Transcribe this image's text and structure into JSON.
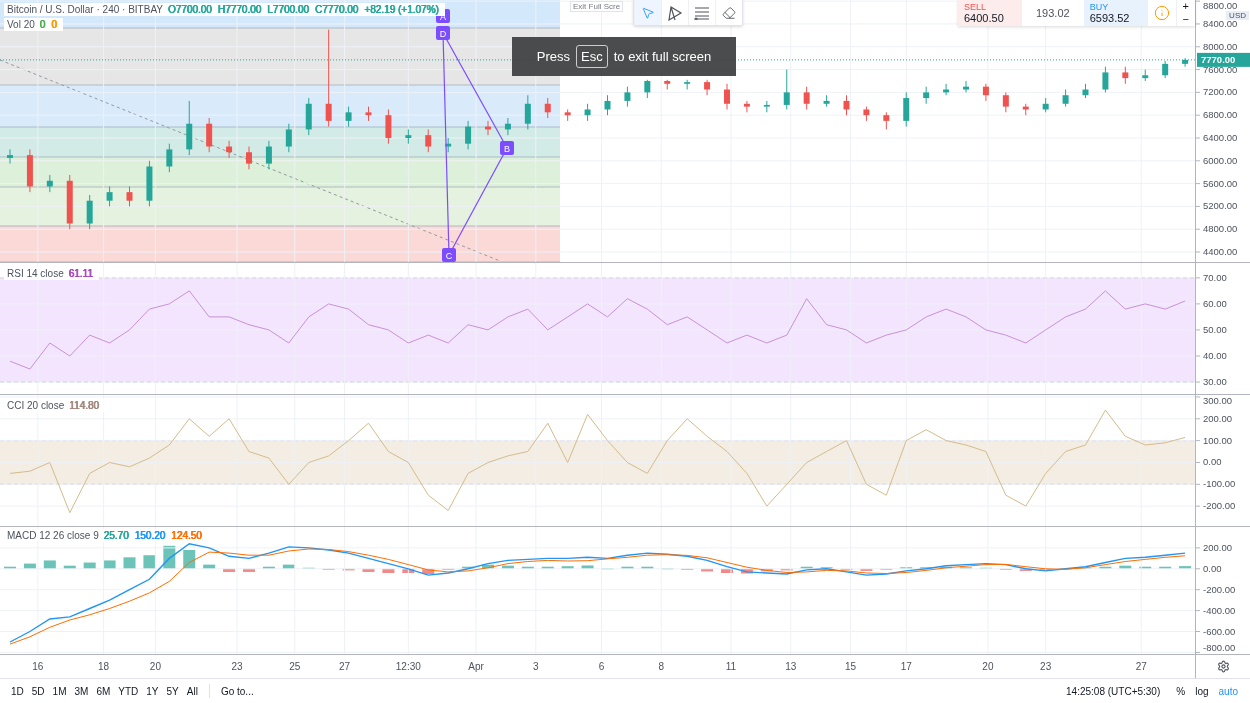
{
  "tooltip": {
    "text": "Exit Full Scre"
  },
  "drawing_toolbar": {
    "tools": [
      {
        "kind": "cursor",
        "selected": true
      },
      {
        "kind": "pattern",
        "selected": false
      },
      {
        "kind": "lines",
        "selected": false
      },
      {
        "kind": "eraser",
        "selected": false
      }
    ]
  },
  "trade_panel": {
    "sell": {
      "label": "SELL",
      "price": "6400.50"
    },
    "spread": "193.02",
    "buy": {
      "label": "BUY",
      "price": "6593.52"
    },
    "zoom_in": "+",
    "zoom_out": "−"
  },
  "toast": {
    "before": "Press",
    "key": "Esc",
    "after": "to exit full screen"
  },
  "price_pane": {
    "legend": {
      "title": "Bitcoin / U.S. Dollar · 240 · BITBAY",
      "values": [
        {
          "text": "O7700.00",
          "color": "#26a69a"
        },
        {
          "text": "H7770.00",
          "color": "#26a69a"
        },
        {
          "text": "L7700.00",
          "color": "#26a69a"
        },
        {
          "text": "C7770.00",
          "color": "#26a69a"
        },
        {
          "text": "+82.19 (+1.07%)",
          "color": "#26a69a"
        }
      ]
    },
    "volume_legend": {
      "title": "Vol 20",
      "values": [
        {
          "text": "0",
          "color": "#4caf50"
        },
        {
          "text": "0",
          "color": "#ff9800"
        }
      ]
    },
    "currency": "USD",
    "last_price": "7770.00",
    "pattern": {
      "points": [
        {
          "label": "A"
        },
        {
          "label": "D"
        },
        {
          "label": "B"
        },
        {
          "label": "C"
        }
      ]
    },
    "chart_data": {
      "type": "candlestick",
      "grid": true,
      "ylim": [
        4225,
        8820
      ],
      "yticks": [
        {
          "value": 8800,
          "label": "8800.00"
        },
        {
          "value": 8400,
          "label": "8400.00"
        },
        {
          "value": 8000,
          "label": "8000.00"
        },
        {
          "value": 7600,
          "label": "7600.00"
        },
        {
          "value": 7200,
          "label": "7200.00"
        },
        {
          "value": 6800,
          "label": "6800.00"
        },
        {
          "value": 6400,
          "label": "6400.00"
        },
        {
          "value": 6000,
          "label": "6000.00"
        },
        {
          "value": 5600,
          "label": "5600.00"
        },
        {
          "value": 5200,
          "label": "5200.00"
        },
        {
          "value": 4800,
          "label": "4800.00"
        },
        {
          "value": 4400,
          "label": "4400.00"
        }
      ],
      "ohlc": [
        [
          6050,
          6200,
          5950,
          6100
        ],
        [
          6100,
          6200,
          5450,
          5550
        ],
        [
          5550,
          5750,
          5450,
          5650
        ],
        [
          5650,
          5750,
          4800,
          4900
        ],
        [
          4900,
          5400,
          4800,
          5300
        ],
        [
          5300,
          5550,
          5200,
          5450
        ],
        [
          5450,
          5550,
          5200,
          5300
        ],
        [
          5300,
          6000,
          5200,
          5900
        ],
        [
          5900,
          6300,
          5800,
          6200
        ],
        [
          6200,
          7050,
          6100,
          6650
        ],
        [
          6650,
          6750,
          6150,
          6250
        ],
        [
          6250,
          6350,
          6050,
          6150
        ],
        [
          6150,
          6250,
          5850,
          5950
        ],
        [
          5950,
          6350,
          5850,
          6250
        ],
        [
          6250,
          6650,
          6150,
          6550
        ],
        [
          6550,
          7100,
          6450,
          7000
        ],
        [
          7000,
          8300,
          6600,
          6700
        ],
        [
          6700,
          6950,
          6600,
          6850
        ],
        [
          6850,
          6950,
          6700,
          6800
        ],
        [
          6800,
          6900,
          6300,
          6400
        ],
        [
          6400,
          6550,
          6300,
          6450
        ],
        [
          6450,
          6550,
          6150,
          6250
        ],
        [
          6250,
          6400,
          6150,
          6300
        ],
        [
          6300,
          6700,
          6200,
          6600
        ],
        [
          6600,
          6700,
          6450,
          6550
        ],
        [
          6550,
          6750,
          6450,
          6650
        ],
        [
          6650,
          7150,
          6550,
          7000
        ],
        [
          7000,
          7100,
          6750,
          6850
        ],
        [
          6850,
          6900,
          6700,
          6800
        ],
        [
          6800,
          7000,
          6700,
          6900
        ],
        [
          6900,
          7150,
          6800,
          7050
        ],
        [
          7050,
          7300,
          6950,
          7200
        ],
        [
          7200,
          7420,
          7100,
          7400
        ],
        [
          7400,
          7420,
          7250,
          7350
        ],
        [
          7350,
          7420,
          7250,
          7380
        ],
        [
          7380,
          7420,
          7150,
          7250
        ],
        [
          7250,
          7350,
          6900,
          7000
        ],
        [
          7000,
          7050,
          6850,
          6950
        ],
        [
          6950,
          7050,
          6850,
          6980
        ],
        [
          6980,
          7600,
          6900,
          7200
        ],
        [
          7200,
          7300,
          6900,
          7000
        ],
        [
          7000,
          7150,
          6950,
          7050
        ],
        [
          7050,
          7150,
          6800,
          6900
        ],
        [
          6900,
          6950,
          6700,
          6800
        ],
        [
          6800,
          6850,
          6550,
          6700
        ],
        [
          6700,
          7200,
          6600,
          7100
        ],
        [
          7100,
          7300,
          7000,
          7200
        ],
        [
          7200,
          7350,
          7150,
          7250
        ],
        [
          7250,
          7400,
          7200,
          7300
        ],
        [
          7300,
          7350,
          7050,
          7150
        ],
        [
          7150,
          7200,
          6850,
          6950
        ],
        [
          6950,
          7000,
          6800,
          6900
        ],
        [
          6900,
          7100,
          6850,
          7000
        ],
        [
          7000,
          7250,
          6950,
          7150
        ],
        [
          7150,
          7350,
          7100,
          7250
        ],
        [
          7250,
          7650,
          7200,
          7550
        ],
        [
          7550,
          7650,
          7350,
          7450
        ],
        [
          7450,
          7600,
          7400,
          7500
        ],
        [
          7500,
          7750,
          7450,
          7700
        ],
        [
          7700,
          7800,
          7650,
          7770
        ]
      ]
    }
  },
  "rsi_pane": {
    "legend": {
      "title": "RSI 14 close",
      "values": [
        {
          "text": "61.11",
          "color": "#ab47bc"
        }
      ]
    },
    "chart_data": {
      "type": "line",
      "grid": true,
      "ylim": [
        25.4,
        75.7
      ],
      "yticks": [
        {
          "value": 70,
          "label": "70.00"
        },
        {
          "value": 60,
          "label": "60.00"
        },
        {
          "value": 50,
          "label": "50.00"
        },
        {
          "value": 40,
          "label": "40.00"
        },
        {
          "value": 30,
          "label": "30.00"
        }
      ],
      "series": [
        {
          "color": "#c792d8",
          "values": [
            38,
            35,
            45,
            40,
            48,
            45,
            50,
            58,
            60,
            65,
            55,
            55,
            52,
            50,
            45,
            55,
            60,
            58,
            52,
            50,
            45,
            48,
            45,
            52,
            50,
            55,
            58,
            50,
            55,
            60,
            55,
            62,
            58,
            52,
            55,
            50,
            45,
            48,
            45,
            48,
            62,
            52,
            50,
            45,
            48,
            50,
            55,
            58,
            55,
            50,
            48,
            45,
            50,
            55,
            58,
            65,
            58,
            60,
            58,
            61.11
          ]
        }
      ]
    }
  },
  "cci_pane": {
    "legend": {
      "title": "CCI 20 close",
      "values": [
        {
          "text": "114.80",
          "color": "#a1887f"
        }
      ]
    },
    "chart_data": {
      "type": "line",
      "grid": true,
      "ylim": [
        -291,
        309
      ],
      "yticks": [
        {
          "value": 300,
          "label": "300.00"
        },
        {
          "value": 200,
          "label": "200.00"
        },
        {
          "value": 100,
          "label": "100.00"
        },
        {
          "value": 0,
          "label": "0.00"
        },
        {
          "value": -100,
          "label": "-100.00"
        },
        {
          "value": -200,
          "label": "-200.00"
        }
      ],
      "series": [
        {
          "color": "#d4bc8c",
          "values": [
            -50,
            -40,
            0,
            -230,
            -50,
            0,
            -20,
            20,
            80,
            200,
            120,
            200,
            50,
            20,
            -100,
            0,
            30,
            100,
            180,
            50,
            0,
            -150,
            -220,
            -50,
            0,
            30,
            50,
            180,
            0,
            220,
            100,
            0,
            -50,
            100,
            200,
            120,
            50,
            -50,
            -200,
            -100,
            0,
            50,
            100,
            -100,
            -150,
            100,
            150,
            100,
            80,
            50,
            -150,
            -200,
            -50,
            50,
            80,
            240,
            120,
            80,
            90,
            114.8
          ]
        }
      ]
    }
  },
  "macd_pane": {
    "legend": {
      "title": "MACD 12 26 close 9",
      "values": [
        {
          "text": "25.70",
          "color": "#26a69a"
        },
        {
          "text": "150.20",
          "color": "#2196f3"
        },
        {
          "text": "124.50",
          "color": "#ff6d00"
        }
      ]
    },
    "chart_data": {
      "type": "line",
      "grid": true,
      "ylim": [
        -815,
        400
      ],
      "yticks": [
        {
          "value": 200,
          "label": "200.00"
        },
        {
          "value": 0,
          "label": "0.00"
        },
        {
          "value": -200,
          "label": "-200.00"
        },
        {
          "value": -400,
          "label": "-400.00"
        },
        {
          "value": -600,
          "label": "-600.00"
        },
        {
          "value": -800,
          "label": "-800.00"
        }
      ],
      "series": [
        {
          "color": "#2196f3",
          "values": [
            -700,
            -600,
            -480,
            -460,
            -380,
            -300,
            -200,
            -100,
            100,
            240,
            200,
            120,
            100,
            150,
            210,
            200,
            180,
            150,
            100,
            50,
            0,
            -60,
            -40,
            0,
            50,
            80,
            90,
            100,
            100,
            110,
            100,
            130,
            150,
            140,
            120,
            80,
            20,
            -30,
            -40,
            -50,
            -10,
            0,
            -30,
            -60,
            -50,
            -20,
            0,
            30,
            40,
            50,
            40,
            0,
            -20,
            0,
            20,
            60,
            100,
            110,
            130,
            150.2
          ]
        },
        {
          "color": "#ff6d00",
          "values": [
            -720,
            -650,
            -560,
            -490,
            -440,
            -380,
            -310,
            -230,
            -120,
            60,
            160,
            150,
            130,
            130,
            170,
            190,
            185,
            165,
            130,
            90,
            40,
            -10,
            -30,
            -20,
            10,
            50,
            70,
            80,
            75,
            78,
            95,
            110,
            130,
            135,
            128,
            105,
            60,
            15,
            -15,
            -35,
            -30,
            -15,
            -20,
            -40,
            -45,
            -35,
            -15,
            10,
            25,
            40,
            42,
            20,
            0,
            -5,
            10,
            40,
            70,
            90,
            110,
            124.5
          ]
        }
      ]
    }
  },
  "time_axis": [
    "16",
    "18",
    "20",
    "23",
    "25",
    "27",
    "12:30",
    "Apr",
    "3",
    "6",
    "8",
    "11",
    "13",
    "15",
    "17",
    "20",
    "23",
    "27"
  ],
  "bottom_bar": {
    "ranges": [
      "1D",
      "5D",
      "1M",
      "3M",
      "6M",
      "YTD",
      "1Y",
      "5Y",
      "All"
    ],
    "goto": "Go to...",
    "time": "14:25:08 (UTC+5:30)",
    "scale_options": [
      {
        "label": "%",
        "selected": false
      },
      {
        "label": "log",
        "selected": false
      },
      {
        "label": "auto",
        "selected": true
      }
    ]
  }
}
